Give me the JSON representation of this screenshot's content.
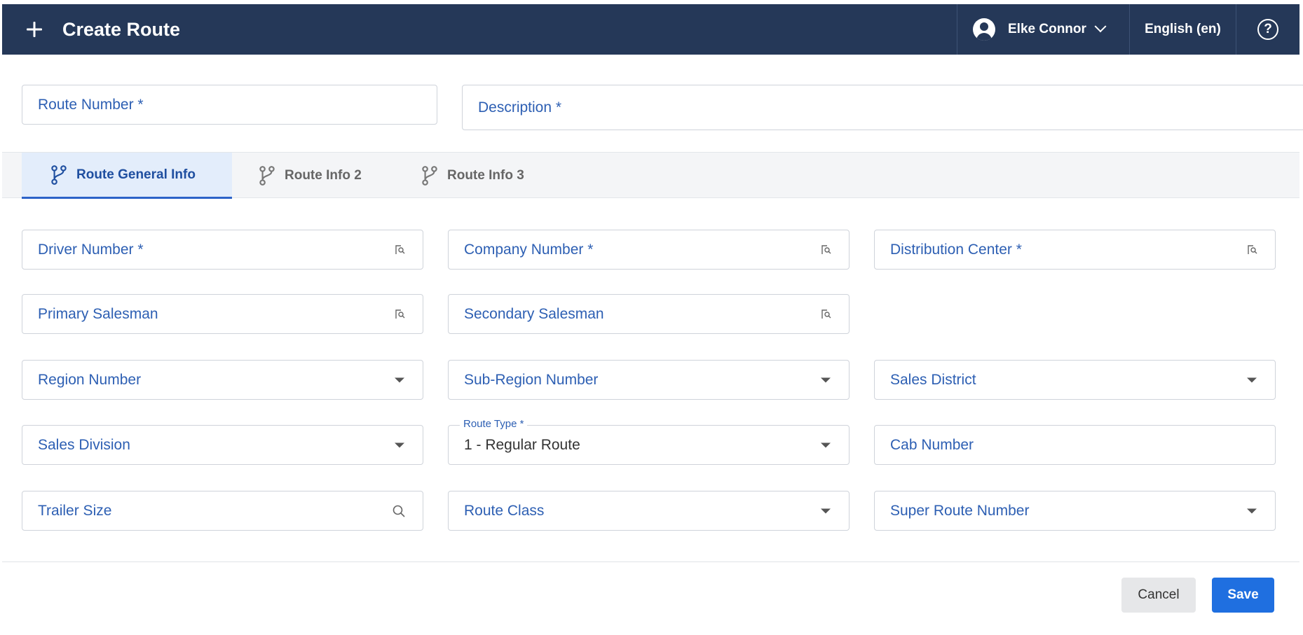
{
  "header": {
    "title": "Create Route",
    "user_name": "Elke Connor",
    "language": "English (en)"
  },
  "top_fields": {
    "route_number": "Route Number *",
    "description": "Description *"
  },
  "tabs": [
    {
      "label": "Route General Info",
      "active": true
    },
    {
      "label": "Route Info 2",
      "active": false
    },
    {
      "label": "Route Info 3",
      "active": false
    }
  ],
  "fields": {
    "driver_number": "Driver Number *",
    "company_number": "Company Number *",
    "distribution_center": "Distribution Center *",
    "primary_salesman": "Primary Salesman",
    "secondary_salesman": "Secondary Salesman",
    "region_number": "Region Number",
    "sub_region_number": "Sub-Region Number",
    "sales_district": "Sales District",
    "sales_division": "Sales Division",
    "route_type_label": "Route Type *",
    "route_type_value": "1 - Regular Route",
    "cab_number": "Cab Number",
    "trailer_size": "Trailer Size",
    "route_class": "Route Class",
    "super_route_number": "Super Route Number"
  },
  "footer": {
    "cancel": "Cancel",
    "save": "Save"
  },
  "colors": {
    "header_bg": "#253858",
    "label_blue": "#2d5fb3",
    "active_tab_bg": "#e3edfb",
    "save_blue": "#1f6fe0"
  }
}
